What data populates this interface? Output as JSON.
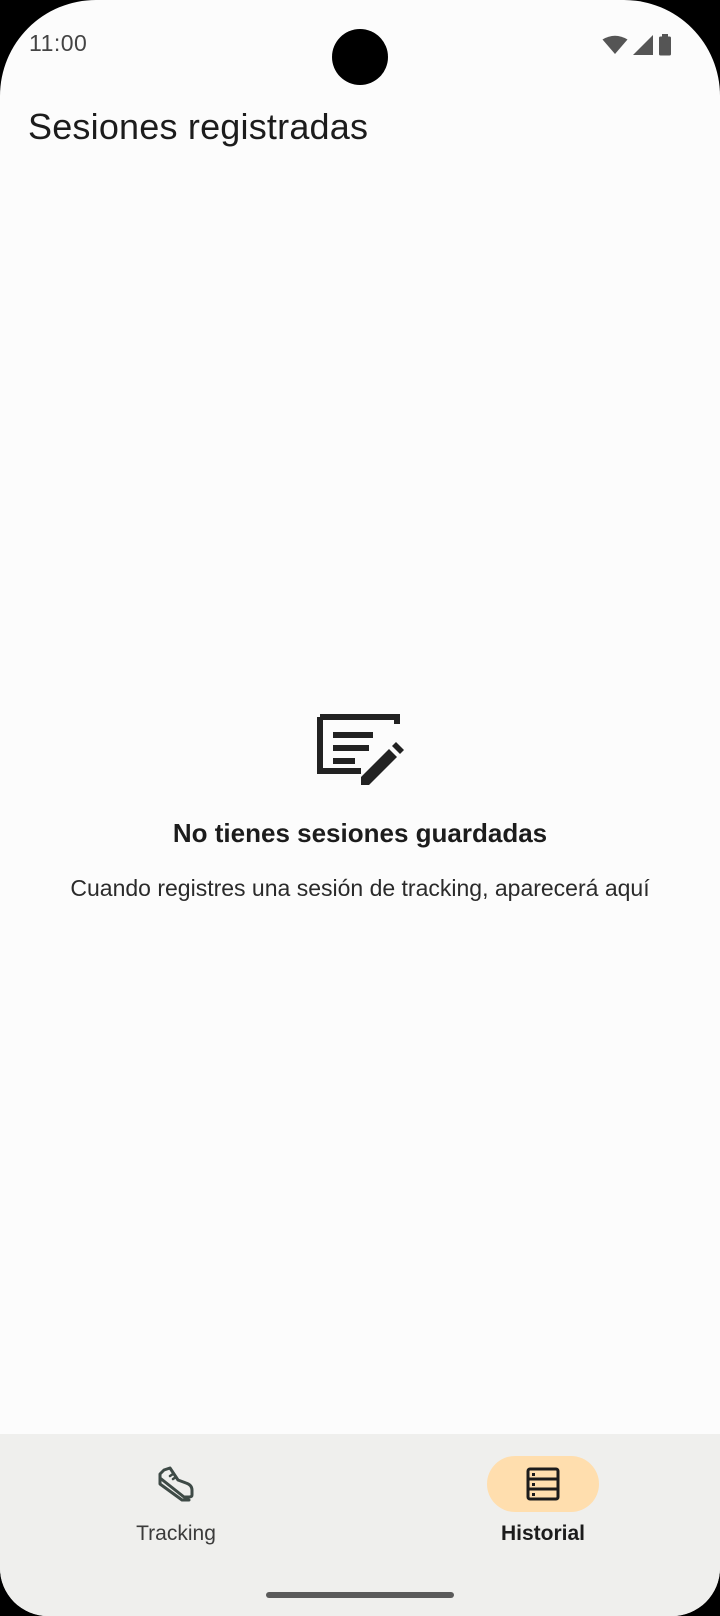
{
  "status_bar": {
    "time": "11:00",
    "icons": [
      "wifi-icon",
      "cellular-signal-icon",
      "battery-icon"
    ]
  },
  "header": {
    "title": "Sesiones registradas"
  },
  "empty_state": {
    "icon": "note-edit-icon",
    "title": "No tienes sesiones guardadas",
    "subtitle": "Cuando registres una sesión de tracking, aparecerá aquí"
  },
  "bottom_nav": {
    "items": [
      {
        "label": "Tracking",
        "icon": "sneaker-icon",
        "active": false
      },
      {
        "label": "Historial",
        "icon": "storage-list-icon",
        "active": true
      }
    ],
    "active_indicator_color": "#ffdeae",
    "background_color": "#efefed"
  }
}
